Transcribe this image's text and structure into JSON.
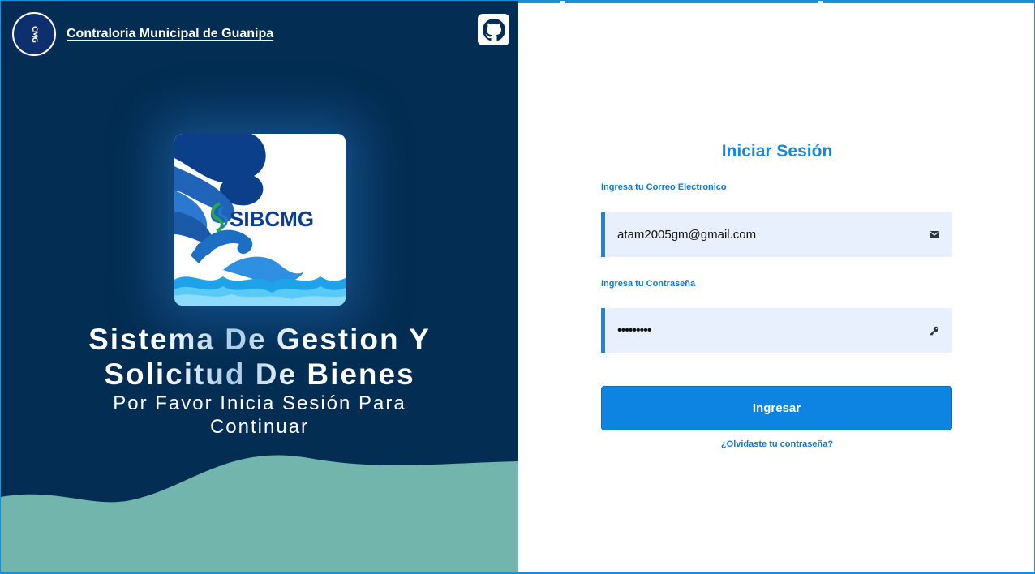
{
  "brand": {
    "logo_text": "CMG",
    "name": "Contraloria Municipal de Guanipa"
  },
  "github_icon": "github-icon",
  "hero": {
    "logo_text": "SIBCMG",
    "title": "Sistema De Gestion Y Solicitud De Bienes",
    "subtitle": "Por Favor Inicia Sesión Para Continuar"
  },
  "login": {
    "title": "Iniciar Sesión",
    "email_label": "Ingresa tu Correo Electronico",
    "email_value": "atam2005gm@gmail.com",
    "email_icon": "envelope-icon",
    "password_label": "Ingresa tu Contraseña",
    "password_value": "•••••••••",
    "password_icon": "key-icon",
    "submit_label": "Ingresar",
    "forgot_label": "¿Olvidaste tu contraseña?"
  },
  "colors": {
    "left_bg": "#032d52",
    "wave": "#72b5ad",
    "accent": "#1688d8",
    "input_bg": "#e8f0fd"
  }
}
